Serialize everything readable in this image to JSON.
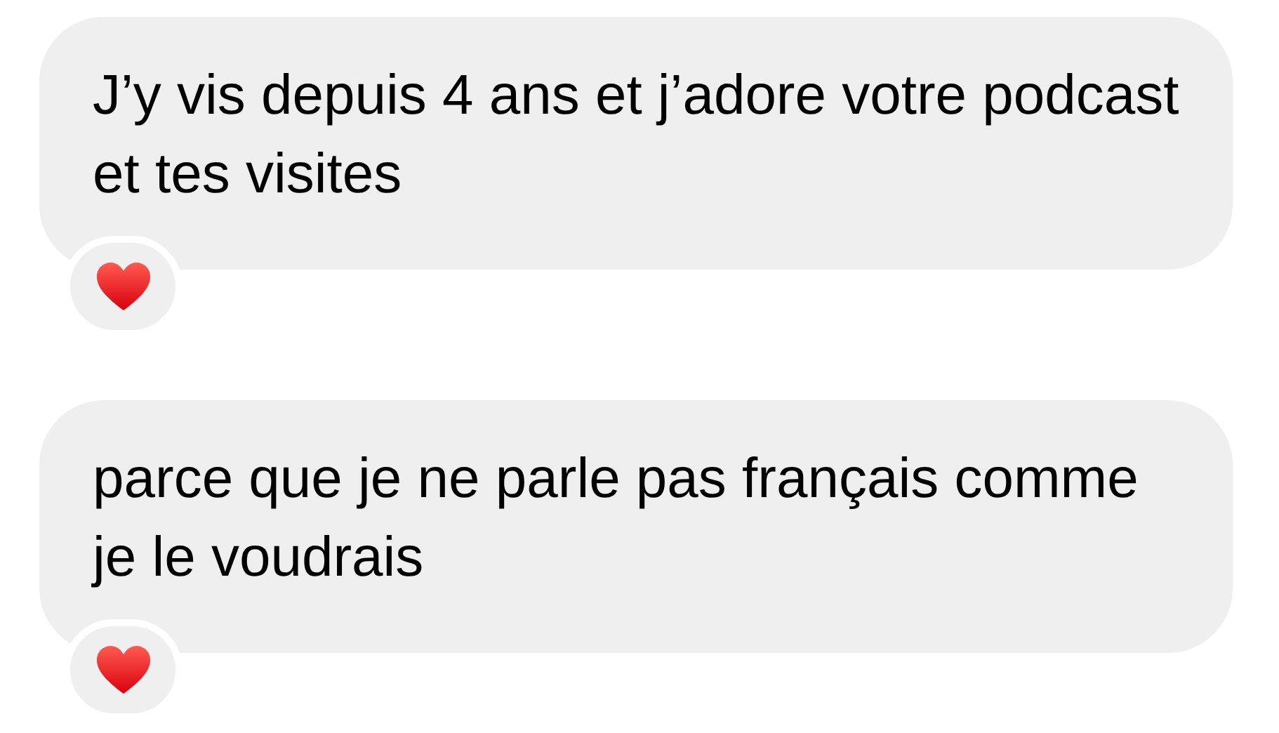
{
  "messages": [
    {
      "text": "J’y vis depuis 4 ans et j’adore votre podcast et tes visites",
      "hearted": true
    },
    {
      "text": "parce que je ne parle pas français comme je le voudrais",
      "hearted": true
    }
  ]
}
